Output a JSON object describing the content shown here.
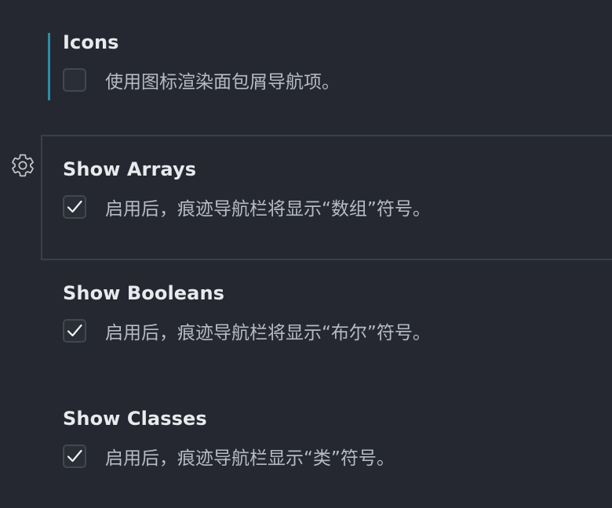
{
  "settings": [
    {
      "title": "Icons",
      "description": "使用图标渲染面包屑导航项。",
      "checked": false
    },
    {
      "title": "Show Arrays",
      "description": "启用后，痕迹导航栏将显示“数组”符号。",
      "checked": true
    },
    {
      "title": "Show Booleans",
      "description": "启用后，痕迹导航栏将显示“布尔”符号。",
      "checked": true
    },
    {
      "title": "Show Classes",
      "description": "启用后，痕迹导航栏显示“类”符号。",
      "checked": true
    }
  ],
  "icons": {
    "gear": "gear-icon",
    "check": "checkmark-icon"
  },
  "colors": {
    "background": "#252830",
    "modified_indicator": "#2a8ea6",
    "title": "#e8eaee",
    "description": "#b7bbc3"
  }
}
